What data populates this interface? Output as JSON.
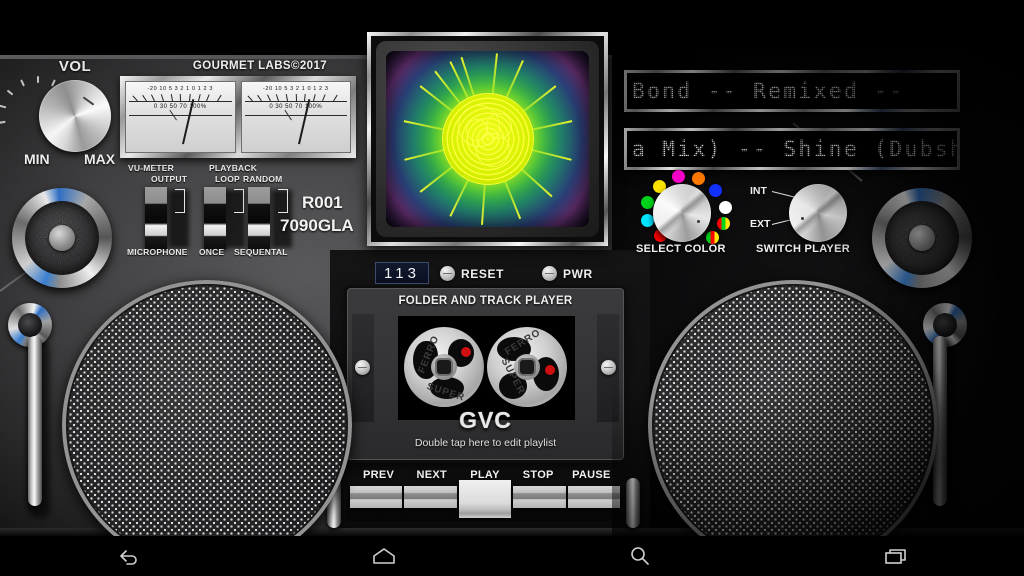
{
  "app": {
    "brand": "GOURMET LABS©2017",
    "model_line1": "R001",
    "model_line2": "7090GLA"
  },
  "volume_knob": {
    "title": "VOL",
    "min_label": "MIN",
    "max_label": "MAX"
  },
  "vu_meters": {
    "scale_top": "-20 10  5  3  2  1  0  1  2  3",
    "scale_bottom": "0  30  50  70 100%",
    "count": 2
  },
  "switches": [
    {
      "name": "vu-meter-output",
      "label_top_1": "VU-METER",
      "label_top_2": "OUTPUT",
      "label_bottom": "MICROPHONE"
    },
    {
      "name": "playback-loop",
      "label_top_1": "PLAYBACK",
      "label_top_2": "LOOP",
      "label_bottom": "ONCE"
    },
    {
      "name": "random-sequental",
      "label_top_1": "",
      "label_top_2": "RANDOM",
      "label_bottom": "SEQUENTAL"
    }
  ],
  "display": {
    "line1": "Bond -- Remixed --",
    "line2": "a Mix) -- Shine (Dubshak"
  },
  "select_color": {
    "caption": "SELECT COLOR",
    "colors": [
      "#ff00d0",
      "#ff7a00",
      "#ffe800",
      "#1230ff",
      "#00d11a",
      "#ffffff",
      "#00e5ff",
      "#ff0000"
    ]
  },
  "switch_player": {
    "caption": "SWITCH PLAYER",
    "option_top": "INT",
    "option_bottom": "EXT"
  },
  "counter": {
    "value": "113",
    "reset_label": "RESET",
    "power_label": "PWR"
  },
  "deck": {
    "title": "FOLDER AND TRACK PLAYER",
    "brand": "GVC",
    "hint": "Double tap here to edit playlist",
    "reel_word_top": "FERRO",
    "reel_word_bottom": "SUPER"
  },
  "transport": {
    "buttons": [
      "PREV",
      "NEXT",
      "PLAY",
      "STOP",
      "PAUSE"
    ]
  },
  "navbar": {
    "items": [
      {
        "name": "back",
        "icon": "back-arrow-icon"
      },
      {
        "name": "home",
        "icon": "home-icon"
      },
      {
        "name": "search",
        "icon": "search-icon"
      },
      {
        "name": "recents",
        "icon": "recents-icon"
      }
    ]
  },
  "visualizer": {
    "name": "crt-visualizer",
    "primary_color": "#e8f000",
    "secondary_color": "#18a84a"
  }
}
